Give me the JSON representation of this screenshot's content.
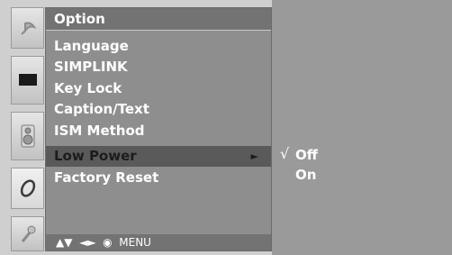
{
  "menu": {
    "title": "Option",
    "items": [
      {
        "label": "Language"
      },
      {
        "label": "SIMPLINK"
      },
      {
        "label": "Key Lock"
      },
      {
        "label": "Caption/Text"
      },
      {
        "label": "ISM Method"
      },
      {
        "label": "Low Power"
      },
      {
        "label": "Factory Reset"
      }
    ],
    "active_index": 5,
    "arrow": "►",
    "nav_hint": "▲▼  ◄►  ◉  MENU"
  },
  "submenu": {
    "check_mark": "√",
    "options": [
      {
        "label": "Off",
        "selected": true
      },
      {
        "label": "On",
        "selected": false
      }
    ]
  },
  "icons": [
    "picture-icon-satellite",
    "screen-icon",
    "speaker-icon",
    "option-disc-icon",
    "lock-key-icon"
  ],
  "colors": {
    "panel": "#8e8e8e",
    "highlight": "#5a5a5a",
    "submenu": "#9a9a9a",
    "text": "#ffffff"
  }
}
